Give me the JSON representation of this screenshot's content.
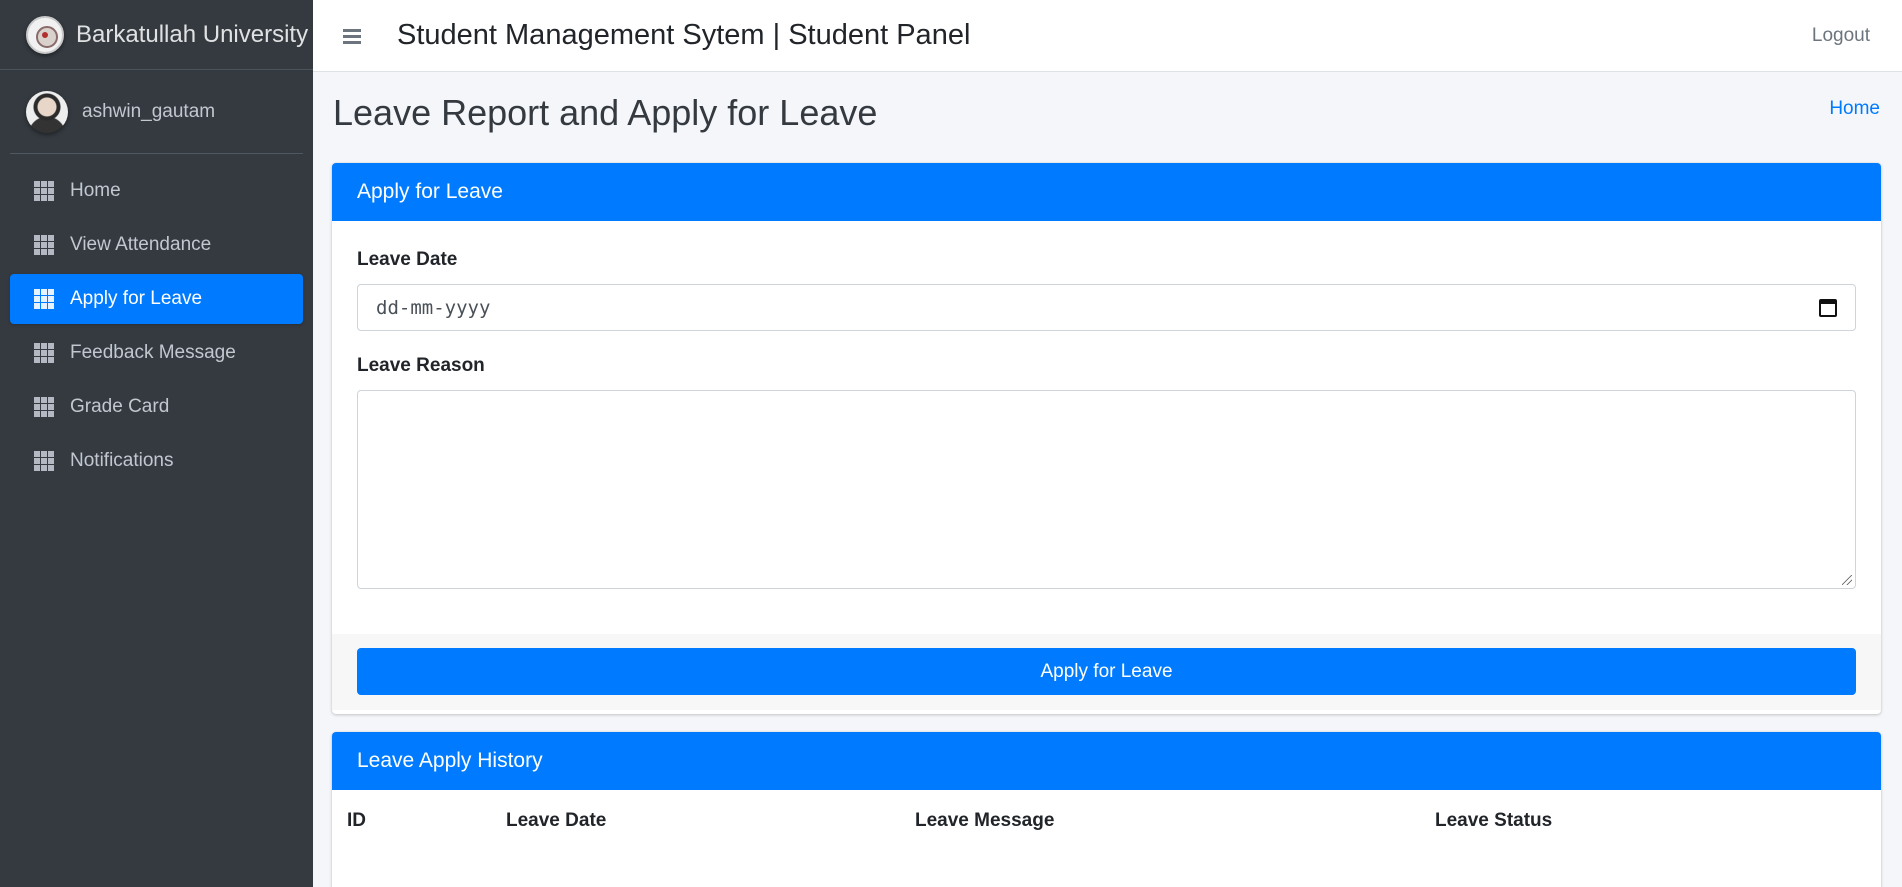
{
  "brand": {
    "name": "Barkatullah University",
    "logo_icon": "university-seal-logo"
  },
  "user": {
    "name": "ashwin_gautam"
  },
  "sidebar": {
    "items": [
      {
        "label": "Home",
        "icon": "grid-icon",
        "active": false
      },
      {
        "label": "View Attendance",
        "icon": "grid-icon",
        "active": false
      },
      {
        "label": "Apply for Leave",
        "icon": "grid-icon",
        "active": true
      },
      {
        "label": "Feedback Message",
        "icon": "grid-icon",
        "active": false
      },
      {
        "label": "Grade Card",
        "icon": "grid-icon",
        "active": false
      },
      {
        "label": "Notifications",
        "icon": "grid-icon",
        "active": false
      }
    ]
  },
  "topbar": {
    "title": "Student Management Sytem | Student Panel",
    "logout_label": "Logout"
  },
  "page": {
    "title": "Leave Report and Apply for Leave",
    "breadcrumb_home": "Home"
  },
  "apply_card": {
    "header": "Apply for Leave",
    "leave_date_label": "Leave Date",
    "leave_date_placeholder": "dd-mm-yyyy",
    "leave_reason_label": "Leave Reason",
    "leave_reason_value": "",
    "submit_label": "Apply for Leave"
  },
  "history_card": {
    "header": "Leave Apply History",
    "columns": [
      "ID",
      "Leave Date",
      "Leave Message",
      "Leave Status"
    ],
    "rows": []
  },
  "colors": {
    "primary": "#007bff",
    "sidebar_bg": "#343a40",
    "content_bg": "#f4f6f9"
  }
}
